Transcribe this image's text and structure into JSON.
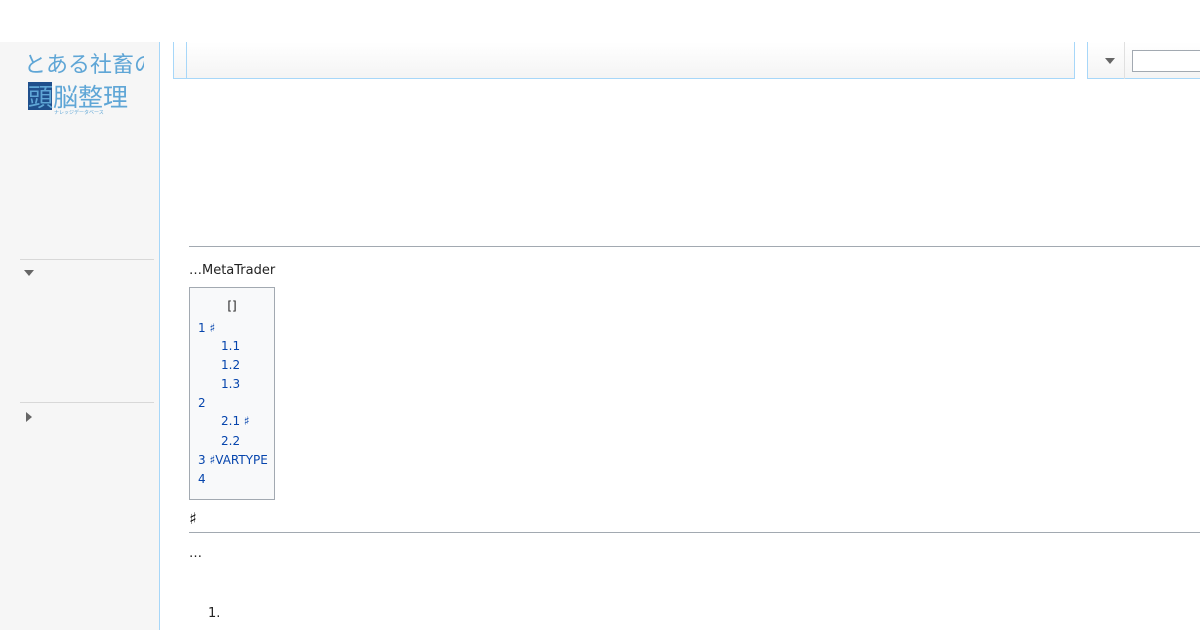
{
  "site": {
    "logo_text_top": "とある社畜の",
    "logo_text_bottom": "頭脳整理",
    "logo_subtext": "ナレッジデータベース"
  },
  "search": {
    "value": "",
    "placeholder": ""
  },
  "content": {
    "intro": "…MetaTrader",
    "toc": {
      "title": "[]",
      "items": [
        {
          "num": "1",
          "label": "♯"
        },
        {
          "num": "1.1",
          "label": ""
        },
        {
          "num": "1.2",
          "label": ""
        },
        {
          "num": "1.3",
          "label": ""
        },
        {
          "num": "2",
          "label": ""
        },
        {
          "num": "2.1",
          "label": "♯"
        },
        {
          "num": "2.2",
          "label": ""
        },
        {
          "num": "3",
          "label": "♯VARTYPE"
        },
        {
          "num": "4",
          "label": ""
        }
      ]
    },
    "section_heading": "♯",
    "paragraph": "…",
    "list_marker": "1."
  },
  "colors": {
    "link": "#0645ad",
    "border_blue": "#a7d7f9",
    "sidebar_bg": "#f6f6f6",
    "logo_dark": "#1f4f8c",
    "logo_light": "#5fa6d6"
  },
  "icons": {
    "portal_expanded": "caret-down-icon",
    "portal_collapsed": "caret-right-icon",
    "more_menu": "caret-down-icon"
  }
}
